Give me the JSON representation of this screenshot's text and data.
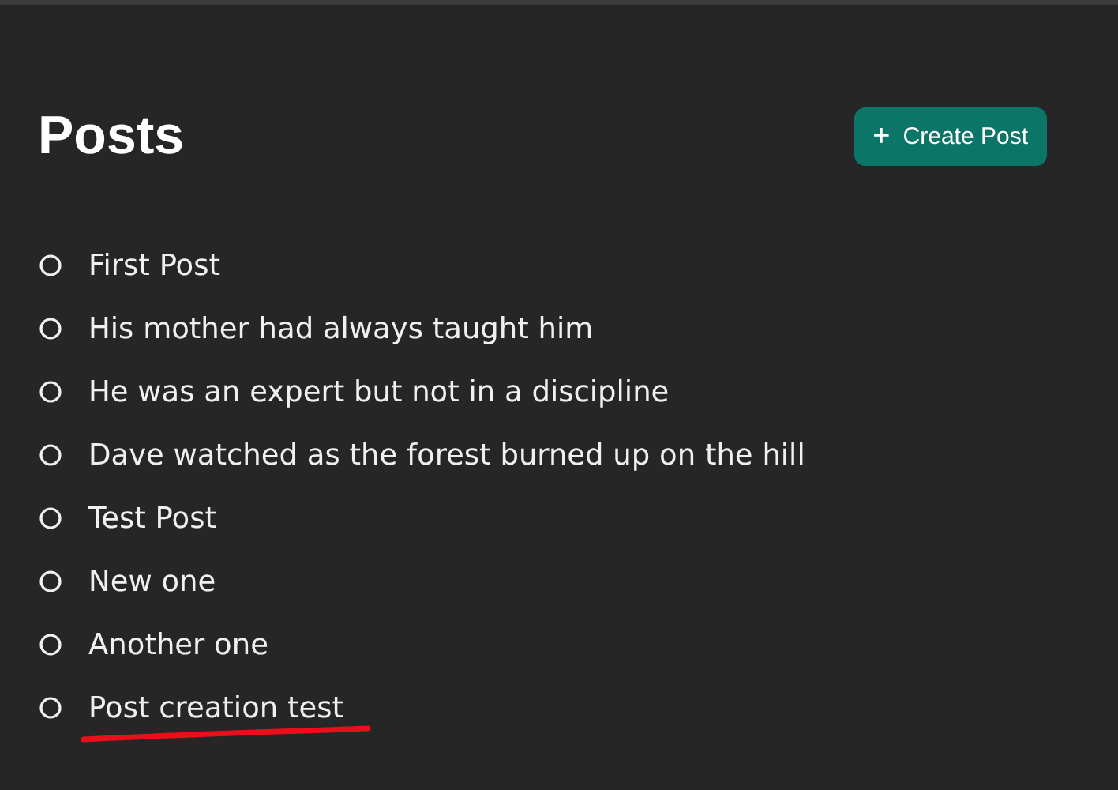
{
  "header": {
    "title": "Posts",
    "create_button": {
      "icon": "+",
      "label": "Create Post"
    }
  },
  "posts": [
    {
      "title": "First Post",
      "underlined": false
    },
    {
      "title": "His mother had always taught him",
      "underlined": false
    },
    {
      "title": "He was an expert but not in a discipline",
      "underlined": false
    },
    {
      "title": "Dave watched as the forest burned up on the hill",
      "underlined": false
    },
    {
      "title": "Test Post",
      "underlined": false
    },
    {
      "title": "New one",
      "underlined": false
    },
    {
      "title": "Another one",
      "underlined": false
    },
    {
      "title": "Post creation test",
      "underlined": true
    }
  ]
}
